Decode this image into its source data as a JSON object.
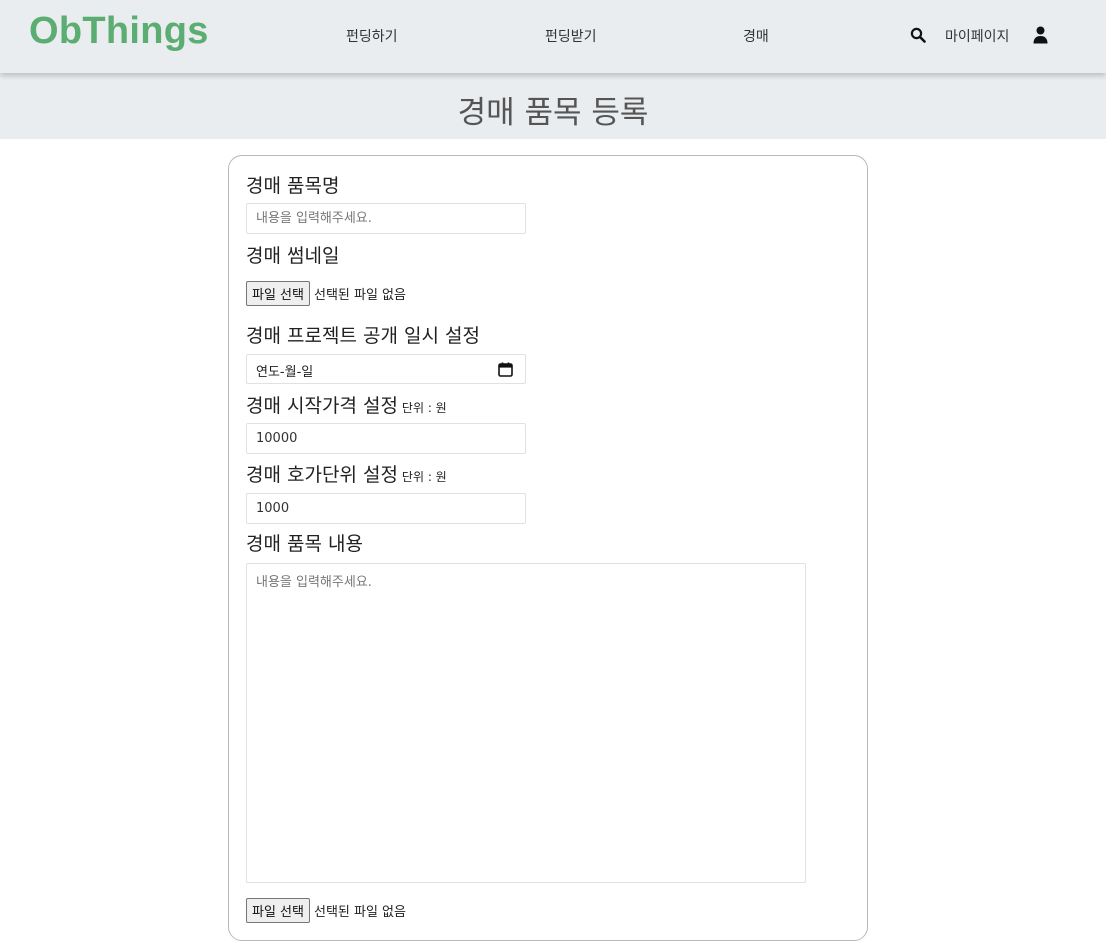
{
  "header": {
    "logo": "ObThings",
    "nav": {
      "funding": "펀딩하기",
      "funded": "펀딩받기",
      "auction": "경매",
      "mypage": "마이페이지"
    },
    "icons": {
      "search": "search-icon",
      "user": "user-icon"
    },
    "logo_color": "#5cad72"
  },
  "page": {
    "title": "경매 품목 등록"
  },
  "form": {
    "item_name": {
      "label": "경매 품목명",
      "placeholder": "내용을 입력해주세요."
    },
    "thumbnail": {
      "label": "경매 썸네일",
      "button": "파일 선택",
      "status": "선택된 파일 없음"
    },
    "open_date": {
      "label": "경매 프로젝트 공개 일시 설정",
      "value": "연도-월-일"
    },
    "start_price": {
      "label": "경매 시작가격 설정",
      "unit": "단위 : 원",
      "value": "10000"
    },
    "bid_unit": {
      "label": "경매 호가단위 설정",
      "unit": "단위 : 원",
      "value": "1000"
    },
    "content": {
      "label": "경매 품목 내용",
      "placeholder": "내용을 입력해주세요."
    },
    "content_file": {
      "button": "파일 선택",
      "status": "선택된 파일 없음"
    }
  }
}
